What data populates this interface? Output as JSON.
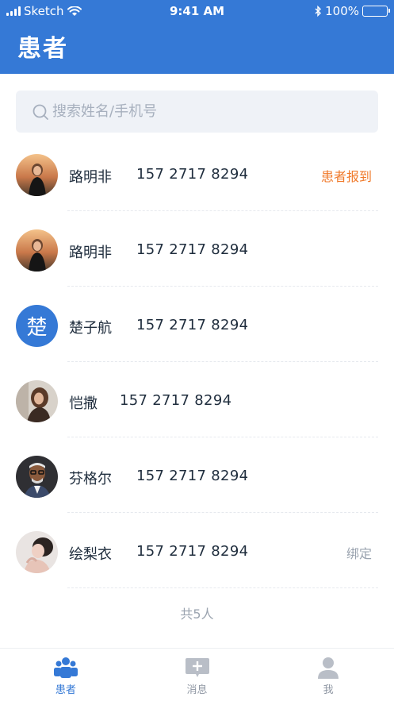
{
  "status_bar": {
    "carrier": "Sketch",
    "time": "9:41 AM",
    "battery": "100%"
  },
  "header": {
    "title": "患者"
  },
  "search": {
    "placeholder": "搜索姓名/手机号"
  },
  "patients": [
    {
      "name": "路明非",
      "phone": "157 2717 8294",
      "tag": "患者报到",
      "tag_color": "#F07A2B",
      "avatar": "photo-woman-sunset"
    },
    {
      "name": "路明非",
      "phone": "157 2717 8294",
      "tag": "",
      "avatar": "photo-woman-sunset"
    },
    {
      "name": "楚子航",
      "phone": "157 2717 8294",
      "tag": "",
      "avatar_letter": "楚",
      "avatar": "letter"
    },
    {
      "name": "恺撒",
      "phone": "157 2717 8294",
      "tag": "",
      "avatar": "photo-woman-brown-hair"
    },
    {
      "name": "芬格尔",
      "phone": "157 2717 8294",
      "tag": "",
      "avatar": "photo-man-glasses"
    },
    {
      "name": "绘梨衣",
      "phone": "157 2717 8294",
      "tag": "绑定",
      "tag_color": "#9aa3af",
      "avatar": "photo-woman-light"
    }
  ],
  "total_text": "共5人",
  "tabbar": {
    "items": [
      {
        "label": "患者",
        "icon": "patients-icon",
        "active": true
      },
      {
        "label": "消息",
        "icon": "message-icon",
        "active": false
      },
      {
        "label": "我",
        "icon": "profile-icon",
        "active": false
      }
    ]
  },
  "colors": {
    "primary": "#3579D6",
    "inactive": "#8f97a3"
  }
}
